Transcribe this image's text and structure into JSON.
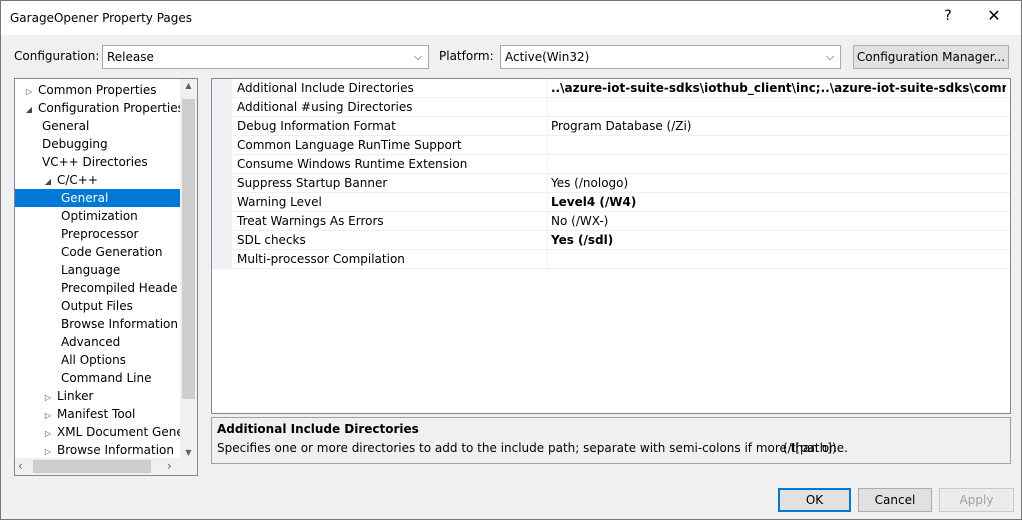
{
  "window": {
    "title": "GarageOpener Property Pages",
    "help_glyph": "?",
    "close_glyph": "✕"
  },
  "toolbar": {
    "configuration_label": "Configuration:",
    "configuration_value": "Release",
    "platform_label": "Platform:",
    "platform_value": "Active(Win32)",
    "config_manager_label": "Configuration Manager..."
  },
  "tree": {
    "items": [
      {
        "label": "Common Properties",
        "expander": "▷"
      },
      {
        "label": "Configuration Properties",
        "expander": "◢"
      },
      {
        "label": "General"
      },
      {
        "label": "Debugging"
      },
      {
        "label": "VC++ Directories"
      },
      {
        "label": "C/C++",
        "expander": "◢"
      },
      {
        "label": "General"
      },
      {
        "label": "Optimization"
      },
      {
        "label": "Preprocessor"
      },
      {
        "label": "Code Generation"
      },
      {
        "label": "Language"
      },
      {
        "label": "Precompiled Heade"
      },
      {
        "label": "Output Files"
      },
      {
        "label": "Browse Information"
      },
      {
        "label": "Advanced"
      },
      {
        "label": "All Options"
      },
      {
        "label": "Command Line"
      },
      {
        "label": "Linker",
        "expander": "▷"
      },
      {
        "label": "Manifest Tool",
        "expander": "▷"
      },
      {
        "label": "XML Document Genera",
        "expander": "▷"
      },
      {
        "label": "Browse Information",
        "expander": "▷"
      }
    ],
    "selected_index": 6
  },
  "grid": {
    "rows": [
      {
        "name": "Additional Include Directories",
        "value": "..\\azure-iot-suite-sdks\\iothub_client\\inc;..\\azure-iot-suite-sdks\\common\\inc",
        "bold": true
      },
      {
        "name": "Additional #using Directories",
        "value": "",
        "bold": false
      },
      {
        "name": "Debug Information Format",
        "value": "Program Database (/Zi)",
        "bold": false
      },
      {
        "name": "Common Language RunTime Support",
        "value": "",
        "bold": false
      },
      {
        "name": "Consume Windows Runtime Extension",
        "value": "",
        "bold": false
      },
      {
        "name": "Suppress Startup Banner",
        "value": "Yes (/nologo)",
        "bold": false
      },
      {
        "name": "Warning Level",
        "value": "Level4 (/W4)",
        "bold": true
      },
      {
        "name": "Treat Warnings As Errors",
        "value": "No (/WX-)",
        "bold": false
      },
      {
        "name": "SDL checks",
        "value": "Yes (/sdl)",
        "bold": true
      },
      {
        "name": "Multi-processor Compilation",
        "value": "",
        "bold": false
      }
    ]
  },
  "description": {
    "title": "Additional Include Directories",
    "body": "Specifies one or more directories to add to the include path; separate with semi-colons if more than one.",
    "switch": "(/I[path])"
  },
  "buttons": {
    "ok": "OK",
    "cancel": "Cancel",
    "apply": "Apply"
  },
  "colors": {
    "selection": "#0078d7",
    "window_bg": "#f0f0f0"
  }
}
